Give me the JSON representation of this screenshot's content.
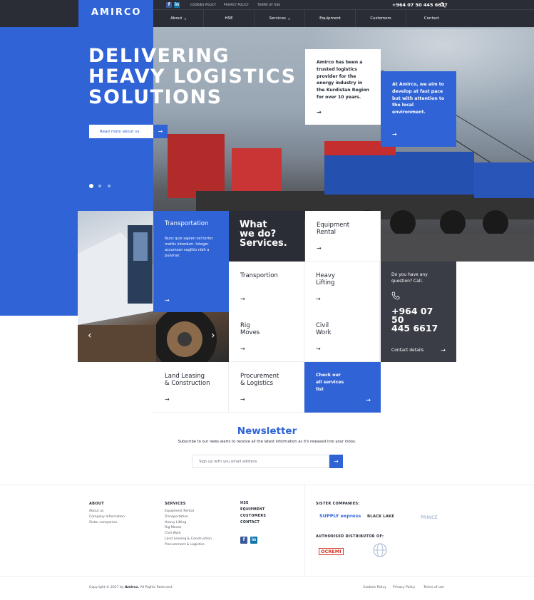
{
  "header": {
    "logo": "AMIRCO",
    "top_links": [
      "COOKIES POLICY",
      "PRIVACY POLICY",
      "TERMS OF USE"
    ],
    "phone": "+964 07 50 445 6617",
    "social": [
      "f",
      "in"
    ],
    "nav": [
      {
        "label": "About",
        "caret": "▾"
      },
      {
        "label": "HSE",
        "caret": ""
      },
      {
        "label": "Services",
        "caret": "▾"
      },
      {
        "label": "Equipment",
        "caret": ""
      },
      {
        "label": "Customers",
        "caret": ""
      },
      {
        "label": "Contact",
        "caret": ""
      }
    ]
  },
  "hero": {
    "title_lines": [
      "DELIVERING",
      "HEAVY LOGISTICS",
      "SOLUTIONS"
    ],
    "button_label": "Read more about us",
    "card_white": "Amirco has been a trusted logistics provider for the energy industry in the Kurdistan Region for over 10 years.",
    "card_blue": "At Amirco, we aim to develop at fast pace but with attention to the local environment.",
    "slider_dots": 3
  },
  "services": {
    "transport_card": {
      "title": "Transportation",
      "text": "Nunc quis sapien vel tortor mattis interdum. Integer accumsan sagittis nibh a pulvinar."
    },
    "what_title_lines": [
      "What",
      "we do?",
      "Services."
    ],
    "tiles": [
      {
        "id": "equipment",
        "lines": [
          "Equipment",
          "Rental"
        ]
      },
      {
        "id": "transportion",
        "lines": [
          "Transportion",
          ""
        ]
      },
      {
        "id": "heavy",
        "lines": [
          "Heavy",
          "Lifting"
        ]
      },
      {
        "id": "rig",
        "lines": [
          "Rig",
          "Moves"
        ]
      },
      {
        "id": "civil",
        "lines": [
          "Civil",
          "Work"
        ]
      },
      {
        "id": "land",
        "lines": [
          "Land Leasing",
          "& Construction"
        ]
      },
      {
        "id": "procurement",
        "lines": [
          "Procurement",
          "& Logistics"
        ]
      }
    ],
    "check_card_lines": [
      "Check our",
      "all services",
      "list"
    ],
    "contact": {
      "question_lines": [
        "Do you have any",
        "question? Call."
      ],
      "phone_lines": [
        "+964 07 50",
        "445 6617"
      ],
      "details_label": "Contact details"
    }
  },
  "newsletter": {
    "title": "Newsletter",
    "subtitle": "Subscribe to our news alerts to receive all the latest information as it's released into your inbox.",
    "placeholder": "Sign up with you email address"
  },
  "footer": {
    "about_title": "ABOUT",
    "about_links": [
      "About us",
      "Company Information",
      "Sister companies"
    ],
    "services_title": "SERVICES",
    "services_links": [
      "Equipment Rental",
      "Transportation",
      "Heavy Lifting",
      "Rig Moves",
      "Civil Work",
      "Land Leasing & Construction",
      "Procurement & Logistics"
    ],
    "main_links": [
      "HSE",
      "EQUIPMENT",
      "CUSTOMERS",
      "CONTACT"
    ],
    "sister_title": "SISTER COMPANIES:",
    "sister_brands": [
      "SUPPLY express",
      "BLACK LAKE",
      "PRINCE"
    ],
    "distributor_title": "AUTHORISED DISTRIBUTOR OF:",
    "distributor_brands": [
      "OCREMI"
    ],
    "copyright_prefix": "Copyright © 2017 by",
    "copyright_brand": "Amirco.",
    "copyright_suffix": "All Rights Reserved.",
    "bottom_links": [
      "Cookies Policy",
      "Privacy Policy",
      "Terms of use"
    ]
  },
  "colors": {
    "accent": "#2f63d6",
    "dark": "#2a2d35",
    "contact": "#3a3d45"
  },
  "icons": [
    "search-icon",
    "arrow-right-icon",
    "phone-icon",
    "facebook-icon",
    "linkedin-icon",
    "chevron-left-icon",
    "chevron-right-icon"
  ]
}
